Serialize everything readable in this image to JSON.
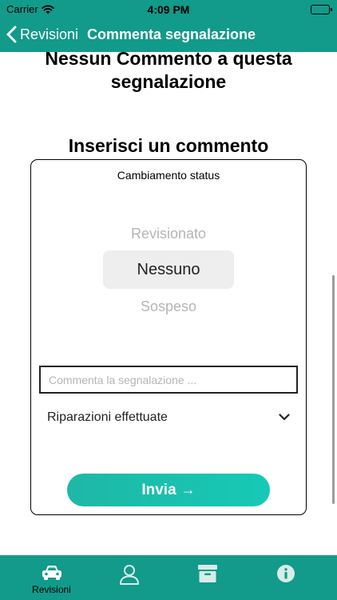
{
  "status_bar": {
    "carrier": "Carrier",
    "time": "4:09 PM"
  },
  "nav": {
    "back_label": "Revisioni",
    "title": "Commenta segnalazione"
  },
  "content": {
    "no_comment_text": "Nessun Commento a questa segnalazione",
    "section_title": "Inserisci un commento"
  },
  "form": {
    "status_label": "Cambiamento status",
    "picker_options": [
      "Revisionato",
      "Nessuno",
      "Sospeso"
    ],
    "picker_selected": "Nessuno",
    "comment_placeholder": "Commenta la segnalazione ...",
    "comment_value": "",
    "dropdown_value": "Riparazioni effettuate",
    "send_label": "Invia",
    "send_arrow": "→"
  },
  "tab_bar": {
    "items": [
      {
        "label": "Revisioni",
        "icon": "car-icon",
        "active": true
      },
      {
        "label": "",
        "icon": "user-icon",
        "active": false
      },
      {
        "label": "",
        "icon": "archive-icon",
        "active": false
      },
      {
        "label": "",
        "icon": "info-icon",
        "active": false
      }
    ]
  },
  "colors": {
    "brand": "#129a8a",
    "button": "#1fb7a6",
    "inactive_icon": "#d8ecea"
  }
}
